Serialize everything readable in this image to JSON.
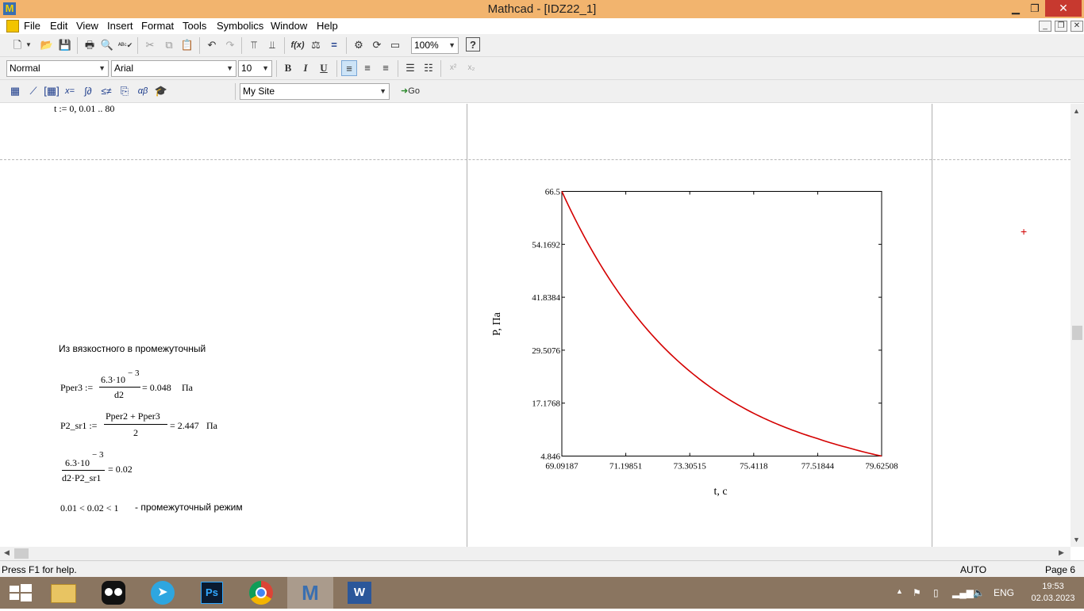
{
  "window": {
    "title": "Mathcad - [IDZ22_1]",
    "app_icon": "M",
    "minimize": "▁",
    "restore": "❐",
    "close": "✕"
  },
  "menu": {
    "items": [
      {
        "label": "File"
      },
      {
        "label": "Edit"
      },
      {
        "label": "View"
      },
      {
        "label": "Insert"
      },
      {
        "label": "Format"
      },
      {
        "label": "Tools"
      },
      {
        "label": "Symbolics"
      },
      {
        "label": "Window"
      },
      {
        "label": "Help"
      }
    ]
  },
  "toolbar": {
    "zoom": "100%",
    "style": "Normal",
    "font": "Arial",
    "font_size": "10",
    "bold": "B",
    "italic": "I",
    "underline": "U",
    "resource": "My Site",
    "go": "Go",
    "help": "?"
  },
  "worksheet": {
    "range_def": "t := 0, 0.01 .. 80",
    "heading": "Из вязкостного в промежуточный",
    "pper3": {
      "lhs": "Pper3 :=",
      "num": "6.3·10",
      "exp": "− 3",
      "den": "d2",
      "result": "= 0.048",
      "unit": "Па"
    },
    "p2sr1": {
      "lhs": "P2_sr1 :=",
      "num": "Pper2 + Pper3",
      "den": "2",
      "result": "= 2.447",
      "unit": "Па"
    },
    "ratio": {
      "num": "6.3·10",
      "exp": "− 3",
      "den": "d2·P2_sr1",
      "result": "= 0.02"
    },
    "conclusion": {
      "ineq": "0.01 < 0.02 < 1",
      "text": "- промежуточный режим"
    }
  },
  "chart_data": {
    "type": "line",
    "title": "",
    "xlabel": "t, c",
    "ylabel": "P, Па",
    "xlim": [
      69.09187,
      79.62508
    ],
    "ylim": [
      4.846,
      66.5
    ],
    "x_ticks": [
      "69.09187",
      "71.19851",
      "73.30515",
      "75.4118",
      "77.51844",
      "79.62508"
    ],
    "y_ticks": [
      "66.5",
      "54.1692",
      "41.8384",
      "29.5076",
      "17.1768",
      "4.846"
    ],
    "series": [
      {
        "color": "#d40000",
        "x": [
          69.09187,
          70.14519,
          71.19851,
          72.25183,
          73.30515,
          74.35848,
          75.4118,
          76.46512,
          77.51844,
          78.57176,
          79.62508
        ],
        "y": [
          66.5,
          52.0,
          40.6,
          31.6,
          24.6,
          19.1,
          14.8,
          11.5,
          8.9,
          6.7,
          4.846
        ]
      }
    ]
  },
  "status": {
    "help": "Press F1 for help.",
    "mode": "AUTO",
    "page": "Page 6"
  },
  "taskbar": {
    "lang": "ENG",
    "time": "19:53",
    "date": "02.03.2023",
    "apps": [
      {
        "name": "file-explorer"
      },
      {
        "name": "owl-app"
      },
      {
        "name": "telegram"
      },
      {
        "name": "photoshop"
      },
      {
        "name": "chrome"
      },
      {
        "name": "mathcad"
      },
      {
        "name": "word"
      }
    ]
  }
}
